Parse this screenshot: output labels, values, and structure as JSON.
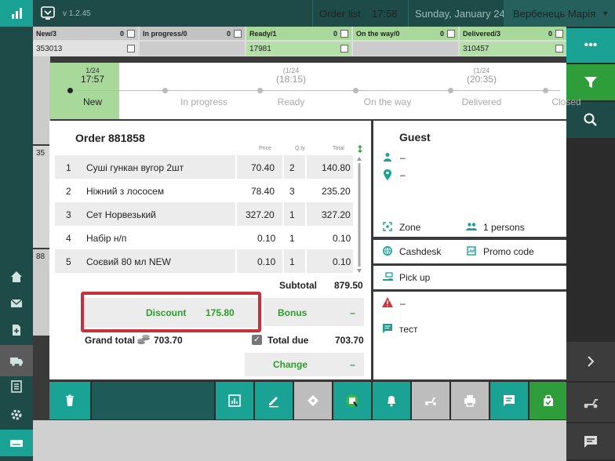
{
  "header": {
    "version": "v 1.2.45",
    "order_list": "Order list",
    "time": "17:58",
    "date": "Sunday, January 24",
    "user": "Вербенець Марія"
  },
  "status_columns": [
    {
      "label": "New/3",
      "count": "0",
      "first_order": "353013"
    },
    {
      "label": "In progress/0",
      "count": "0",
      "first_order": ""
    },
    {
      "label": "Ready/1",
      "count": "0",
      "first_order": "17981"
    },
    {
      "label": "On the way/0",
      "count": "0",
      "first_order": ""
    },
    {
      "label": "Delivered/3",
      "count": "0",
      "first_order": "310457"
    }
  ],
  "progress": {
    "stages": [
      {
        "date": "1/24",
        "time": "17:57",
        "name": "New"
      },
      {
        "date": "",
        "time": "",
        "name": "In progress"
      },
      {
        "date": "(1/24",
        "time": "(18:15)",
        "name": "Ready"
      },
      {
        "date": "",
        "time": "",
        "name": "On the way"
      },
      {
        "date": "(1/24",
        "time": "(20:35)",
        "name": "Delivered"
      },
      {
        "date": "",
        "time": "",
        "name": "Closed"
      }
    ]
  },
  "order": {
    "title": "Order 881858",
    "columns": {
      "price": "Price",
      "qty": "Q.ty",
      "total": "Total"
    },
    "items": [
      {
        "n": "1",
        "name": "Суші гункан вугор 2шт",
        "price": "70.40",
        "qty": "2",
        "total": "140.80"
      },
      {
        "n": "2",
        "name": "Ніжний з лососем",
        "price": "78.40",
        "qty": "3",
        "total": "235.20"
      },
      {
        "n": "3",
        "name": "Сет Норвезький",
        "price": "327.20",
        "qty": "1",
        "total": "327.20"
      },
      {
        "n": "4",
        "name": "Набір н/п",
        "price": "0.10",
        "qty": "1",
        "total": "0.10"
      },
      {
        "n": "5",
        "name": "Соєвий 80 мл NEW",
        "price": "0.10",
        "qty": "1",
        "total": "0.10"
      }
    ],
    "subtotal_label": "Subtotal",
    "subtotal_value": "879.50",
    "discount_label": "Discount",
    "discount_value": "175.80",
    "bonus_label": "Bonus",
    "bonus_value": "–",
    "grand_total_label": "Grand total",
    "grand_total_value": "703.70",
    "total_due_label": "Total due",
    "total_due_value": "703.70",
    "change_label": "Change",
    "change_value": "–"
  },
  "guest": {
    "title": "Guest",
    "name": "–",
    "address": "–",
    "zone": "Zone",
    "persons": "1 persons",
    "cashdesk": "Cashdesk",
    "promo": "Promo code",
    "pickup": "Pick up",
    "alert": "–",
    "comment": "тест"
  },
  "bg_items": {
    "num1": "35",
    "num2": "88"
  },
  "colors": {
    "accent": "#1aa394",
    "green_active": "#2e9e3a",
    "discount_green": "#2a9d2a",
    "highlight_red": "#c4323c"
  }
}
